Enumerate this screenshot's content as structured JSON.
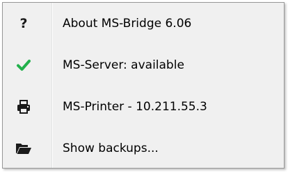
{
  "menu": {
    "items": [
      {
        "label": "About MS-Bridge 6.06",
        "icon": "question-icon"
      },
      {
        "label": "MS-Server: available",
        "icon": "checkmark-icon"
      },
      {
        "label": "MS-Printer - 10.211.55.3",
        "icon": "printer-icon"
      },
      {
        "label": "Show backups...",
        "icon": "folder-open-icon"
      }
    ]
  },
  "colors": {
    "menu_background": "#f0f0f0",
    "border": "#979797",
    "check": "#22b14c",
    "icon_dark": "#1a1a1a"
  }
}
